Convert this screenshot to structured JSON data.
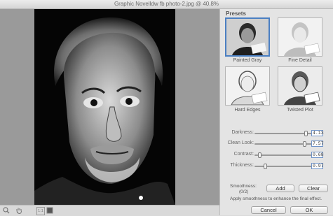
{
  "window": {
    "title": "Graphic Novelldw fb photo-2.jpg @ 40.8%"
  },
  "presets": {
    "title": "Presets",
    "items": [
      {
        "label": "Painted Gray",
        "selected": true
      },
      {
        "label": "Fine Detail",
        "selected": false
      },
      {
        "label": "Hard Edges",
        "selected": false
      },
      {
        "label": "Twisted Plot",
        "selected": false
      }
    ]
  },
  "sliders": [
    {
      "label": "Darkness:",
      "value": "4.13",
      "level": 0.92
    },
    {
      "label": "Clean Look:",
      "value": "7.57",
      "level": 0.9
    },
    {
      "label": "Contrast:",
      "value": "0.68",
      "level": 0.07
    },
    {
      "label": "Thickness:",
      "value": "0.97",
      "level": 0.17
    }
  ],
  "smoothness": {
    "label": "Smoothness:",
    "count": "(0/2)",
    "add_label": "Add",
    "clear_label": "Clear"
  },
  "hint": "Apply smoothness to enhance the final effect.",
  "buttons": {
    "cancel": "Cancel",
    "ok": "OK"
  },
  "toolbar": {
    "zoom_ratio": "1:1"
  },
  "colors": {
    "accent": "#4a7fc2",
    "panel": "#e4e4e4"
  },
  "icons": [
    "zoom-icon",
    "hand-icon",
    "actual-size-icon",
    "fit-icon"
  ]
}
